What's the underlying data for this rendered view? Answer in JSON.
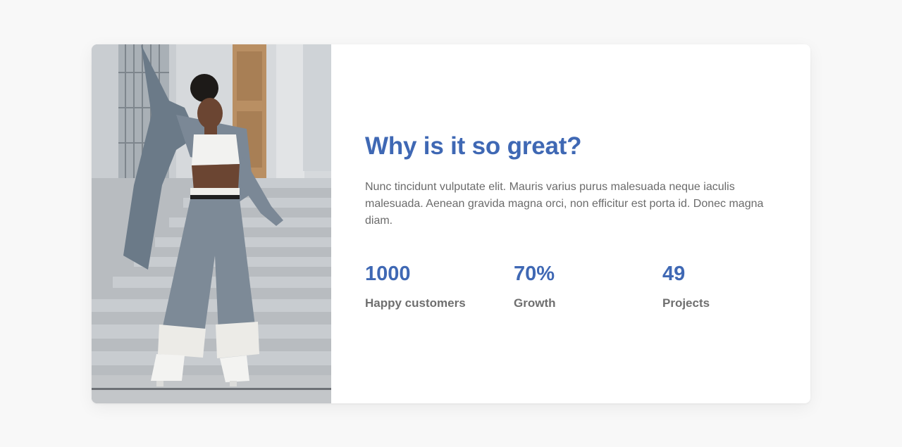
{
  "section": {
    "title": "Why is it so great?",
    "description": "Nunc tincidunt vulputate elit. Mauris varius purus malesuada neque iaculis malesuada. Aenean gravida magna orci, non efficitur est porta id. Donec magna diam."
  },
  "stats": [
    {
      "value": "1000",
      "label": "Happy customers"
    },
    {
      "value": "70%",
      "label": "Growth"
    },
    {
      "value": "49",
      "label": "Projects"
    }
  ],
  "colors": {
    "accent": "#3f68b4",
    "text": "#6b6b6b",
    "background": "#f8f8f8",
    "card": "#ffffff"
  }
}
